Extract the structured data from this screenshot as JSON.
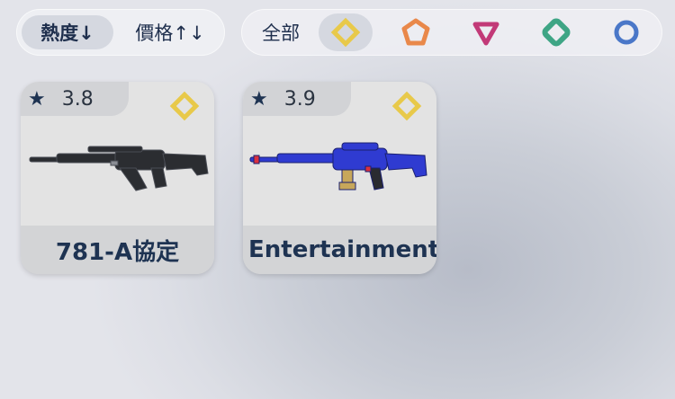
{
  "sort": {
    "popularity_label": "熱度↓",
    "price_label": "價格↑↓"
  },
  "filter": {
    "all_label": "全部",
    "tiers": [
      {
        "icon": "gold-diamond-icon",
        "color": "#e8c94a",
        "active": true
      },
      {
        "icon": "orange-pentagon-icon",
        "color": "#e9884a",
        "active": false
      },
      {
        "icon": "magenta-triangle-icon",
        "color": "#c23a78",
        "active": false
      },
      {
        "icon": "green-diamond-icon",
        "color": "#3ea585",
        "active": false
      },
      {
        "icon": "blue-circle-icon",
        "color": "#4a77c8",
        "active": false
      }
    ]
  },
  "cards": [
    {
      "rating": "3.8",
      "name": "781-A協定",
      "tier": "gold-diamond-icon",
      "weapon_color": "#2b2d31"
    },
    {
      "rating": "3.9",
      "name": "Entertainment S",
      "tier": "gold-diamond-icon",
      "weapon_color": "#2f3bd1"
    }
  ]
}
